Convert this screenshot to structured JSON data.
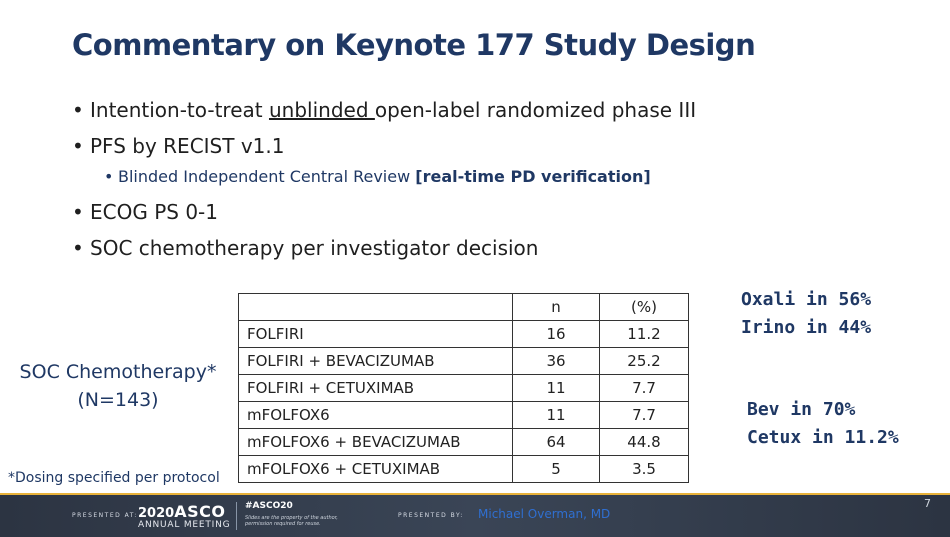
{
  "slide": {
    "title": "Commentary on Keynote 177 Study Design",
    "bullets": [
      {
        "pre": "Intention-to-treat ",
        "underlined": "unblinded ",
        "post": "open-label randomized phase III"
      },
      {
        "text": "PFS by RECIST v1.1"
      },
      {
        "sub_text": "Blinded Independent Central Review ",
        "sub_bold": "[real-time PD verification]"
      },
      {
        "text": "ECOG PS 0-1"
      },
      {
        "text": "SOC chemotherapy per investigator decision"
      }
    ],
    "table": {
      "headers": [
        "",
        "n",
        "(%)"
      ],
      "rows": [
        [
          "FOLFIRI",
          "16",
          "11.2"
        ],
        [
          "FOLFIRI + BEVACIZUMAB",
          "36",
          "25.2"
        ],
        [
          "FOLFIRI + CETUXIMAB",
          "11",
          "7.7"
        ],
        [
          "mFOLFOX6",
          "11",
          "7.7"
        ],
        [
          "mFOLFOX6 + BEVACIZUMAB",
          "64",
          "44.8"
        ],
        [
          "mFOLFOX6 + CETUXIMAB",
          "5",
          "3.5"
        ]
      ]
    },
    "soc_label": {
      "line1": "SOC Chemotherapy*",
      "line2": "(N=143)"
    },
    "notes": {
      "oxali": "Oxali in 56%",
      "irino": "Irino in 44%",
      "bev": "Bev in 70%",
      "cetux": "Cetux in 11.2%"
    },
    "footnote": "*Dosing specified per protocol",
    "page_number": "7"
  },
  "footer": {
    "presented_at": "PRESENTED AT:",
    "year": "2020",
    "asco": "ASCO",
    "meeting": "ANNUAL MEETING",
    "hashtag": "#ASCO20",
    "fine_print": "Slides are the property of the author, permission required for reuse.",
    "presented_by": "PRESENTED BY:",
    "presenter": "Michael Overman, MD"
  },
  "colors": {
    "title": "#1f3864",
    "footer_bg": "#2c3442",
    "accent": "#e8b23a",
    "presenter": "#2f6fd1"
  }
}
